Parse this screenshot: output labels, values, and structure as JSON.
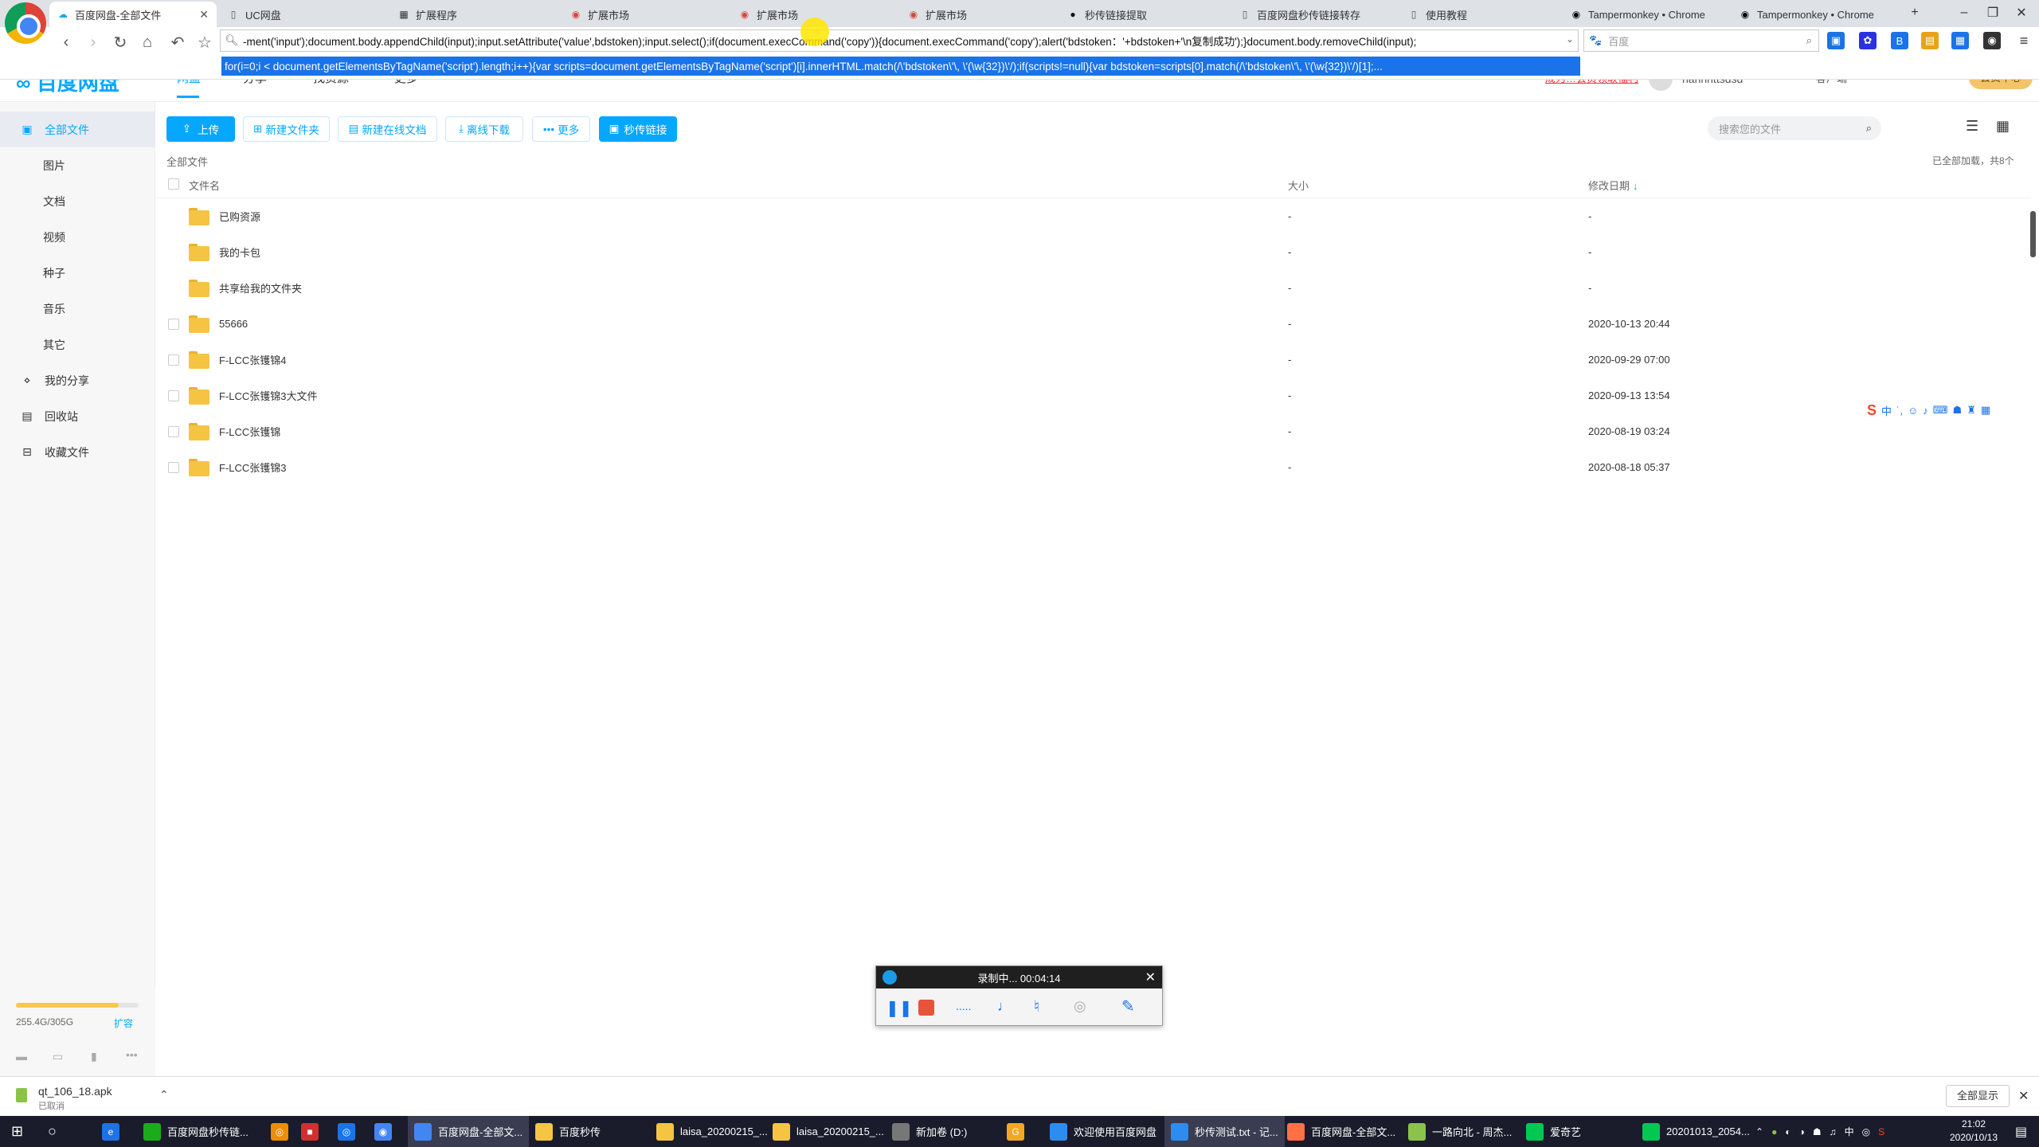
{
  "browser": {
    "tabs": [
      {
        "label": "百度网盘-全部文件",
        "active": true,
        "icon": "baidu-icon"
      },
      {
        "label": "UC网盘",
        "icon": "page-icon"
      },
      {
        "label": "扩展程序",
        "icon": "puzzle-icon"
      },
      {
        "label": "扩展市场",
        "icon": "chrome-icon"
      },
      {
        "label": "扩展市场",
        "icon": "chrome-icon"
      },
      {
        "label": "扩展市场",
        "icon": "chrome-icon"
      },
      {
        "label": "秒传链接提取",
        "icon": "github-icon"
      },
      {
        "label": "百度网盘秒传链接转存",
        "icon": "page-icon"
      },
      {
        "label": "使用教程",
        "icon": "page-icon"
      },
      {
        "label": "Tampermonkey • Chrome",
        "icon": "tampermonkey-icon"
      },
      {
        "label": "Tampermonkey • Chrome",
        "icon": "tampermonkey-icon"
      }
    ],
    "new_tab": "+",
    "url": "-ment('input');document.body.appendChild(input);input.setAttribute('value',bdstoken);input.select();if(document.execCommand('copy')){document.execCommand('copy');alert('bdstoken：'+bdstoken+'\\n复制成功');}document.body.removeChild(input);",
    "suggestion": "for(i=0;i < document.getElementsByTagName('script').length;i++){var scripts=document.getElementsByTagName('script')[i].innerHTML.match(/\\'bdstoken\\'\\, \\'(\\w{32})\\'/);if(scripts!=null){var bdstoken=scripts[0].match(/\\'bdstoken\\'\\, \\'(\\w{32})\\'/)[1];...",
    "search_placeholder": "百度"
  },
  "site": {
    "logo": "百度网盘",
    "nav": [
      "网盘",
      "分享",
      "找资源",
      "更多"
    ],
    "user": "hanhhttsdsd",
    "right_links": [
      "成为…会员领取福利",
      "客户端",
      "会员中心"
    ]
  },
  "sidebar": {
    "items": [
      {
        "label": "全部文件",
        "icon": "file-icon",
        "active": true
      },
      {
        "label": "图片",
        "sub": true
      },
      {
        "label": "文档",
        "sub": true
      },
      {
        "label": "视频",
        "sub": true
      },
      {
        "label": "种子",
        "sub": true
      },
      {
        "label": "音乐",
        "sub": true
      },
      {
        "label": "其它",
        "sub": true
      },
      {
        "label": "我的分享",
        "icon": "share-icon"
      },
      {
        "label": "回收站",
        "icon": "trash-icon"
      },
      {
        "label": "收藏文件",
        "icon": "collect-icon"
      }
    ],
    "quota": "255.4G/305G",
    "quota_fraction": 0.84,
    "expand": "扩容"
  },
  "actions": {
    "upload": "上传",
    "new_folder": "新建文件夹",
    "new_doc": "新建在线文档",
    "offline": "离线下载",
    "more": "更多",
    "quick_link": "秒传链接",
    "search_placeholder": "搜索您的文件"
  },
  "listing": {
    "breadcrumb": "全部文件",
    "loaded": "已全部加载，共8个",
    "col_name": "文件名",
    "col_size": "大小",
    "col_date": "修改日期",
    "rows": [
      {
        "name": "已购资源",
        "size": "-",
        "date": "-",
        "special": true
      },
      {
        "name": "我的卡包",
        "size": "-",
        "date": "-",
        "special": true
      },
      {
        "name": "共享给我的文件夹",
        "size": "-",
        "date": "-",
        "special": true
      },
      {
        "name": "55666",
        "size": "-",
        "date": "2020-10-13 20:44"
      },
      {
        "name": "F-LCC张镬锦4",
        "size": "-",
        "date": "2020-09-29 07:00"
      },
      {
        "name": "F-LCC张镬锦3大文件",
        "size": "-",
        "date": "2020-09-13 13:54"
      },
      {
        "name": "F-LCC张镬锦",
        "size": "-",
        "date": "2020-08-19 03:24"
      },
      {
        "name": "F-LCC张镬锦3",
        "size": "-",
        "date": "2020-08-18 05:37"
      }
    ]
  },
  "recorder": {
    "title": "录制中... 00:04:14"
  },
  "download": {
    "file": "qt_106_18.apk",
    "status": "已取消",
    "show_all": "全部显示"
  },
  "taskbar": {
    "items": [
      "百度网盘秒传链...",
      "",
      "",
      "",
      "",
      "百度网盘-全部文...",
      "百度秒传",
      "laisa_20200215_...",
      "laisa_20200215_...",
      "新加卷 (D:)",
      "",
      "欢迎使用百度网盘",
      "秒传测试.txt - 记...",
      "百度网盘-全部文...",
      "一路向北 - 周杰...",
      "爱奇艺",
      "20201013_2054..."
    ],
    "time": "21:02",
    "date": "2020/10/13"
  },
  "colors": {
    "accent": "#06a7ff",
    "quota": "#f6c94b",
    "folder": "#f5c443",
    "taskbar": "#1a1c2b"
  }
}
